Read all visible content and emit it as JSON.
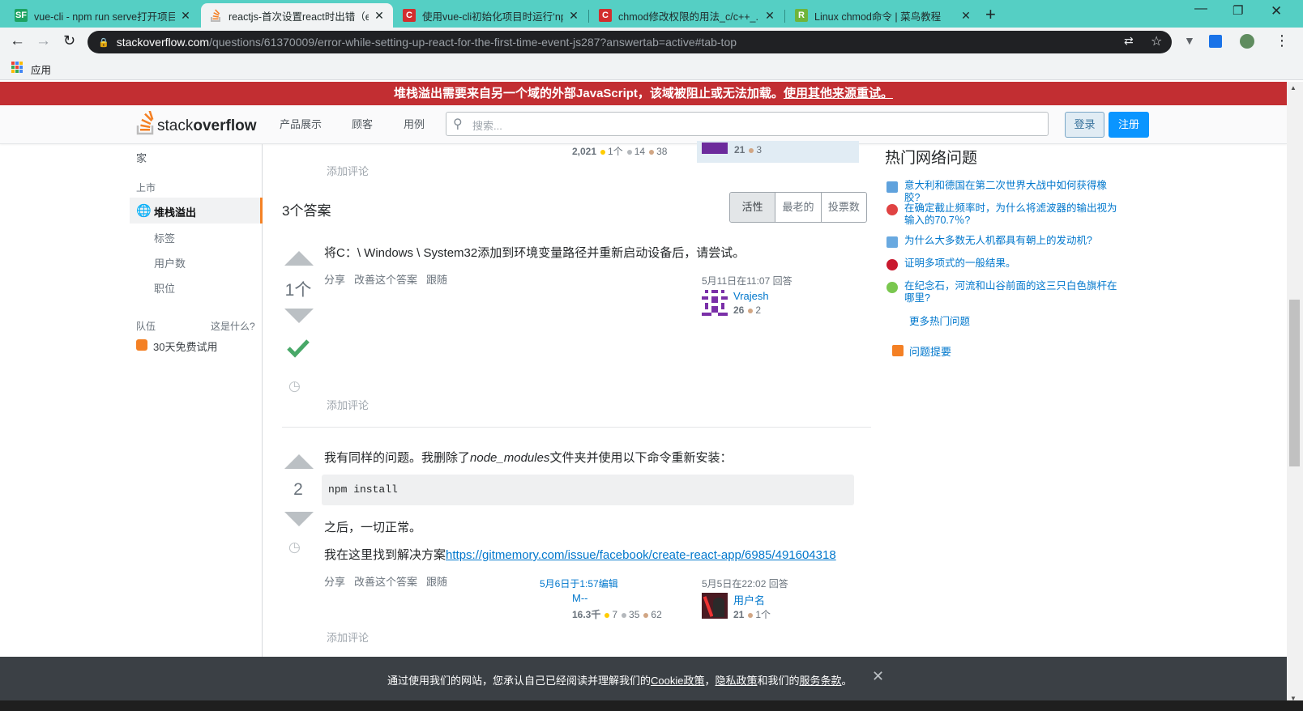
{
  "browser": {
    "tabs": [
      {
        "title": "vue-cli - npm run serve打开项目...",
        "favicon": "SF",
        "color": "#1da362"
      },
      {
        "title": "reactjs-首次设置react时出错（e...",
        "favicon": "so",
        "color": "#f48024"
      },
      {
        "title": "使用vue-cli初始化项目时运行‘np...",
        "favicon": "C",
        "color": "#d22e2e"
      },
      {
        "title": "chmod修改权限的用法_c/c++_...",
        "favicon": "C",
        "color": "#d22e2e"
      },
      {
        "title": "Linux chmod命令 | 菜鸟教程",
        "favicon": "R",
        "color": "#6fb53a"
      }
    ],
    "url_host": "stackoverflow.com",
    "url_path": "/questions/61370009/error-while-setting-up-react-for-the-first-time-event-js287?answertab=active#tab-top",
    "bookmarks_label": "应用"
  },
  "warning_banner": {
    "text": "堆栈溢出需要来自另一个域的外部JavaScript，该域被阻止或无法加载。",
    "link": "使用其他来源重试。"
  },
  "header": {
    "logo_prefix": "stack",
    "logo_suffix": "overflow",
    "nav": [
      "产品展示",
      "顾客",
      "用例"
    ],
    "search_placeholder": "搜索...",
    "login": "登录",
    "register": "注册"
  },
  "leftnav": {
    "home": "家",
    "public_heading": "上市",
    "stackoverflow": "堆栈溢出",
    "tags": "标签",
    "users": "用户数",
    "jobs": "职位",
    "teams_heading": "队伍",
    "whats_this": "这是什么?",
    "trial": "30天免费试用"
  },
  "question_tail": {
    "add_comment": "添加评论",
    "author_rep": "2,021",
    "author_gold": "1个",
    "author_silver": "14",
    "author_bronze": "38",
    "editor_rep": "21",
    "editor_bronze": "3"
  },
  "answers": {
    "heading": "3个答案",
    "sort": [
      "活性",
      "最老的",
      "投票数"
    ],
    "list": [
      {
        "votes": "1个",
        "text": "将C：\\ Windows \\ System32添加到环境变量路径并重新启动设备后，请尝试。",
        "menu": [
          "分享",
          "改善这个答案",
          "跟随"
        ],
        "answered": "5月11日在11:07 回答",
        "user": "Vrajesh",
        "rep": "26",
        "bronze": "2",
        "add_comment": "添加评论"
      },
      {
        "votes": "2",
        "text_pre": "我有同样的问题。我删除了",
        "text_em": "node_modules",
        "text_post": "文件夹并使用以下命令重新安装：",
        "code": "npm install",
        "after": "之后，一切正常。",
        "found_pre": "我在这里找到解决方案",
        "found_link": "https://gitmemory.com/issue/facebook/create-react-app/6985/491604318",
        "menu": [
          "分享",
          "改善这个答案",
          "跟随"
        ],
        "edited": "5月6日于1:57编辑",
        "editor": "M--",
        "editor_rep": "16.3千",
        "editor_gold": "7",
        "editor_silver": "35",
        "editor_bronze": "62",
        "answered": "5月5日在22:02 回答",
        "user": "用户名",
        "rep": "21",
        "bronze": "1个",
        "add_comment": "添加评论"
      }
    ]
  },
  "hot": {
    "title": "热门网络问题",
    "items": [
      {
        "text": "意大利和德国在第二次世界大战中如何获得橡胶?",
        "color": "#5fa2dd"
      },
      {
        "text": "在确定截止频率时，为什么将滤波器的输出视为输入的70.7％?",
        "color": "#e04343"
      },
      {
        "text": "为什么大多数无人机都具有朝上的发动机?",
        "color": "#69a9e0"
      },
      {
        "text": "证明多项式的一般结果。",
        "color": "#c9192e"
      },
      {
        "text": "在纪念石，河流和山谷前面的这三只白色旗杆在哪里?",
        "color": "#7ac74f"
      }
    ],
    "more": "更多热门问题",
    "feed": "问题提要"
  },
  "cookie": {
    "pre": "通过使用我们的网站，您承认自己已经阅读并理解我们的",
    "cookie_link": "Cookie政策",
    "sep": "，",
    "privacy_link": "隐私政策",
    "mid": "和我们的",
    "terms_link": "服务条款",
    "end": "。"
  }
}
